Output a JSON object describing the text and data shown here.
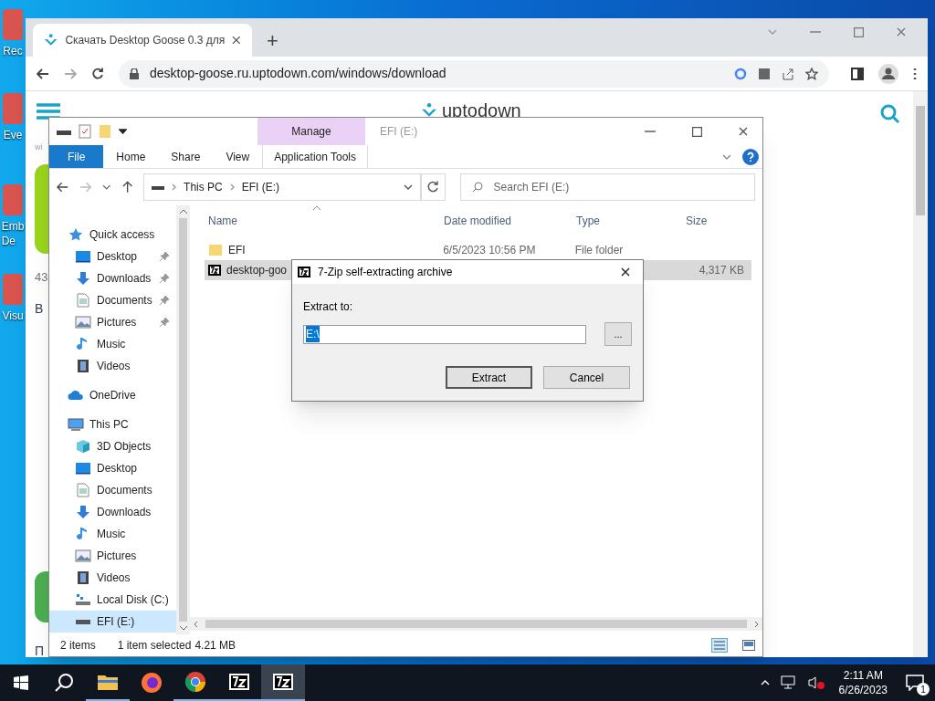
{
  "desktop": {
    "icons": [
      {
        "label": "Rec"
      },
      {
        "label": "Eve"
      },
      {
        "label": "Emb\nDe"
      },
      {
        "label": "Visu"
      }
    ]
  },
  "browser": {
    "tabs": [
      {
        "title": "Скачать Desktop Goose 0.3 для",
        "selected": true
      }
    ],
    "new_tab": "+",
    "address": "desktop-goose.ru.uptodown.com/windows/download",
    "page": {
      "logo": "uptodown",
      "fragments": [
        {
          "text": "wi"
        },
        {
          "text": "43"
        },
        {
          "text": "В"
        },
        {
          "text": "П"
        }
      ]
    }
  },
  "explorer": {
    "context_header": "Manage",
    "title": "EFI (E:)",
    "ribbon_tabs": [
      {
        "label": "File",
        "kind": "file",
        "selected": false
      },
      {
        "label": "Home",
        "kind": "tab",
        "selected": false
      },
      {
        "label": "Share",
        "kind": "tab",
        "selected": false
      },
      {
        "label": "View",
        "kind": "tab",
        "selected": false
      },
      {
        "label": "Application Tools",
        "kind": "context",
        "selected": false
      }
    ],
    "breadcrumb": [
      "This PC",
      "EFI (E:)"
    ],
    "search": {
      "placeholder": "Search EFI (E:)"
    },
    "nav": [
      {
        "label": "Quick access",
        "kind": "star",
        "selected": false,
        "children": [
          {
            "label": "Desktop",
            "kind": "desktop",
            "pinned": true,
            "selected": false
          },
          {
            "label": "Downloads",
            "kind": "downloads",
            "pinned": true,
            "selected": false
          },
          {
            "label": "Documents",
            "kind": "documents",
            "pinned": true,
            "selected": false
          },
          {
            "label": "Pictures",
            "kind": "pictures",
            "pinned": true,
            "selected": false
          },
          {
            "label": "Music",
            "kind": "music",
            "pinned": false,
            "selected": false
          },
          {
            "label": "Videos",
            "kind": "videos",
            "pinned": false,
            "selected": false
          }
        ]
      },
      {
        "label": "OneDrive",
        "kind": "cloud",
        "selected": false
      },
      {
        "label": "This PC",
        "kind": "pc",
        "selected": false,
        "children": [
          {
            "label": "3D Objects",
            "kind": "cube",
            "pinned": false,
            "selected": false
          },
          {
            "label": "Desktop",
            "kind": "desktop",
            "pinned": false,
            "selected": false
          },
          {
            "label": "Documents",
            "kind": "documents",
            "pinned": false,
            "selected": false
          },
          {
            "label": "Downloads",
            "kind": "downloads",
            "pinned": false,
            "selected": false
          },
          {
            "label": "Music",
            "kind": "music",
            "pinned": false,
            "selected": false
          },
          {
            "label": "Pictures",
            "kind": "pictures",
            "pinned": false,
            "selected": false
          },
          {
            "label": "Videos",
            "kind": "videos",
            "pinned": false,
            "selected": false
          },
          {
            "label": "Local Disk (C:)",
            "kind": "disk",
            "pinned": false,
            "selected": false
          },
          {
            "label": "EFI (E:)",
            "kind": "drive",
            "pinned": false,
            "selected": true
          }
        ]
      }
    ],
    "columns": [
      "Name",
      "Date modified",
      "Type",
      "Size"
    ],
    "rows": [
      {
        "kind": "folder",
        "name": "EFI",
        "date": "6/5/2023 10:56 PM",
        "type": "File folder",
        "size": "",
        "selected": false
      },
      {
        "kind": "archive",
        "name": "desktop-goo",
        "date": "",
        "type": "",
        "size": "4,317 KB",
        "selected": true
      }
    ],
    "status": {
      "count": "2 items",
      "selection": "1 item selected",
      "size": "4.21 MB"
    }
  },
  "dialog": {
    "title": "7-Zip self-extracting archive",
    "label": "Extract to:",
    "path": "E:\\",
    "browse": "...",
    "buttons": [
      {
        "label": "Extract",
        "default": true
      },
      {
        "label": "Cancel",
        "default": false
      }
    ]
  },
  "taskbar": {
    "apps": [
      {
        "kind": "explorer",
        "running": true,
        "selected": false
      },
      {
        "kind": "firefox",
        "running": false,
        "selected": false
      },
      {
        "kind": "chrome",
        "running": true,
        "selected": false
      },
      {
        "kind": "archive",
        "running": true,
        "selected": false
      },
      {
        "kind": "archive",
        "running": true,
        "selected": true
      }
    ],
    "time": "2:11 AM",
    "date": "6/26/2023",
    "notifications": "1"
  }
}
